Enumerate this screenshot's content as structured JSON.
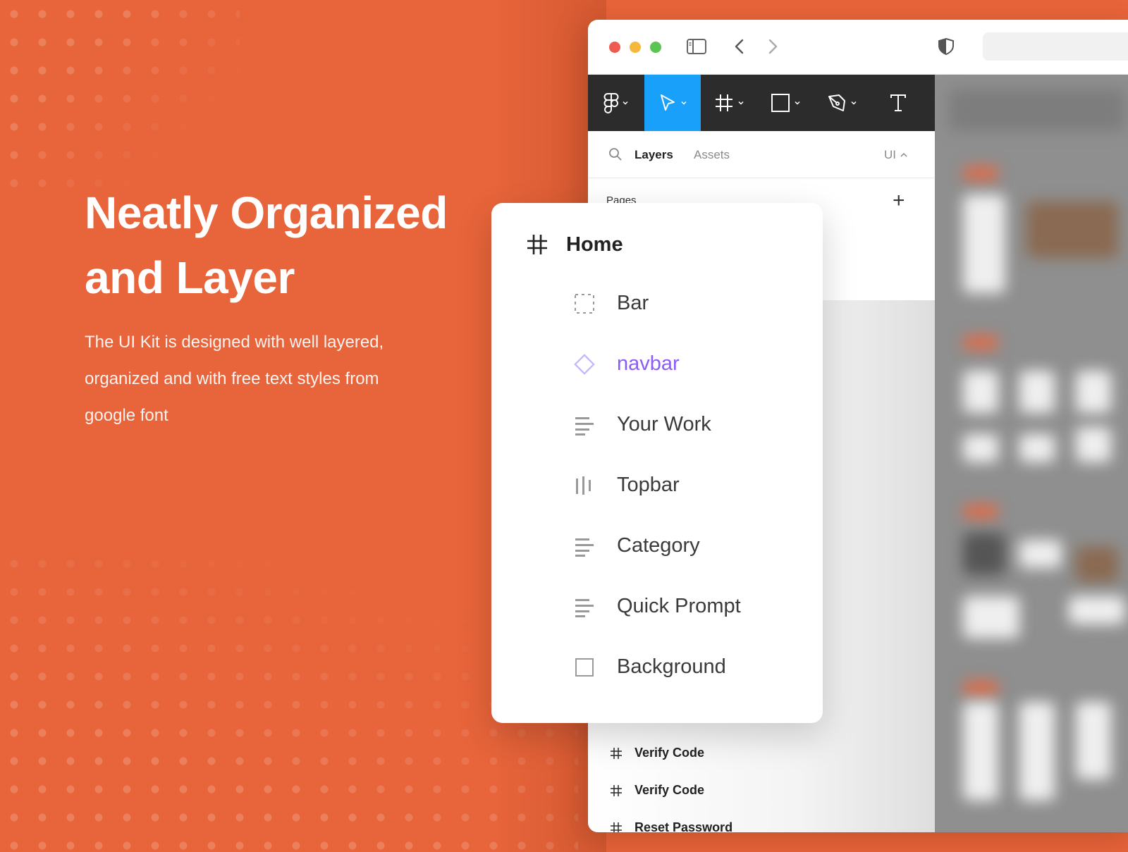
{
  "hero": {
    "title_line1": "Neatly Organized",
    "title_line2": "and Layer",
    "desc_line1": "The UI Kit is designed with well layered,",
    "desc_line2": "organized and with free text styles from",
    "desc_line3": "google font"
  },
  "panel": {
    "tab_layers": "Layers",
    "tab_assets": "Assets",
    "page_selector": "UI",
    "pages_heading": "Pages",
    "add_page": "+",
    "rows": [
      {
        "label": "Verify Code"
      },
      {
        "label": "Verify Code"
      },
      {
        "label": "Reset Password"
      }
    ]
  },
  "toolbar": {
    "tools": [
      "figma-menu-icon",
      "move-icon",
      "frame-icon",
      "rectangle-icon",
      "pen-icon",
      "text-icon"
    ]
  },
  "layers_card": {
    "frame_name": "Home",
    "items": [
      {
        "label": "Bar",
        "icon": "dashed-frame-icon"
      },
      {
        "label": "navbar",
        "icon": "component-instance-icon"
      },
      {
        "label": "Your Work",
        "icon": "auto-layout-vertical-icon"
      },
      {
        "label": "Topbar",
        "icon": "auto-layout-horizontal-icon"
      },
      {
        "label": "Category",
        "icon": "auto-layout-vertical-icon"
      },
      {
        "label": "Quick Prompt",
        "icon": "auto-layout-vertical-icon"
      },
      {
        "label": "Background",
        "icon": "rectangle-icon"
      }
    ]
  },
  "colors": {
    "background": "#E8643A",
    "toolbar": "#2C2C2C",
    "active_tool": "#18A0FB",
    "component": "#8B5CF6"
  }
}
